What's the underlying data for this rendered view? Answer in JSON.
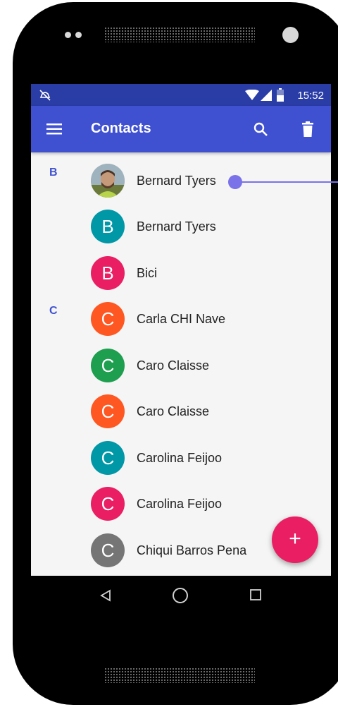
{
  "status_bar": {
    "time": "15:52"
  },
  "app_bar": {
    "title": "Contacts"
  },
  "sections": [
    {
      "letter": "B"
    },
    {
      "letter": "C"
    }
  ],
  "contacts": [
    {
      "name": "Bernard Tyers",
      "initial": "",
      "color": "#6d5a4a",
      "has_photo": true
    },
    {
      "name": "Bernard Tyers",
      "initial": "B",
      "color": "#0097a7"
    },
    {
      "name": "Bici",
      "initial": "B",
      "color": "#e91e63"
    },
    {
      "name": "Carla CHI Nave",
      "initial": "C",
      "color": "#ff5722"
    },
    {
      "name": "Caro Claisse",
      "initial": "C",
      "color": "#1e9e4f"
    },
    {
      "name": "Caro Claisse",
      "initial": "C",
      "color": "#ff5722"
    },
    {
      "name": "Carolina Feijoo",
      "initial": "C",
      "color": "#0097a7"
    },
    {
      "name": "Carolina Feijoo",
      "initial": "C",
      "color": "#e91e63"
    },
    {
      "name": "Chiqui Barros Pena",
      "initial": "C",
      "color": "#757575"
    }
  ],
  "fab": {
    "label": "+",
    "color": "#e91e63"
  },
  "accent": "#3f51d1",
  "status_bar_color": "#2a3da6",
  "callout_color": "#7a72e8"
}
